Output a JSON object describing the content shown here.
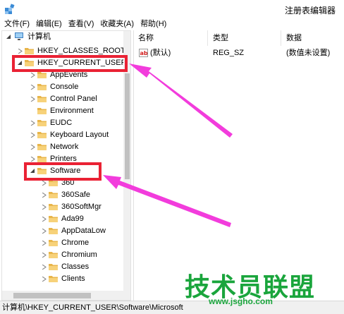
{
  "window": {
    "title": "注册表编辑器",
    "icon": "registry-editor-icon"
  },
  "menu": [
    "文件(F)",
    "编辑(E)",
    "查看(V)",
    "收藏夹(A)",
    "帮助(H)"
  ],
  "tree": {
    "root_label": "计算机",
    "items": [
      {
        "label": "HKEY_CLASSES_ROOT"
      },
      {
        "label": "HKEY_CURRENT_USER",
        "expanded": true
      },
      {
        "label": "AppEvents"
      },
      {
        "label": "Console"
      },
      {
        "label": "Control Panel"
      },
      {
        "label": "Environment"
      },
      {
        "label": "EUDC"
      },
      {
        "label": "Keyboard Layout"
      },
      {
        "label": "Network"
      },
      {
        "label": "Printers"
      },
      {
        "label": "Software",
        "expanded": true
      },
      {
        "label": "360"
      },
      {
        "label": "360Safe"
      },
      {
        "label": "360SoftMgr"
      },
      {
        "label": "Ada99"
      },
      {
        "label": "AppDataLow"
      },
      {
        "label": "Chrome"
      },
      {
        "label": "Chromium"
      },
      {
        "label": "Classes"
      },
      {
        "label": "Clients"
      }
    ]
  },
  "list": {
    "columns": [
      "名称",
      "类型",
      "数据"
    ],
    "rows": [
      {
        "name": "(默认)",
        "type": "REG_SZ",
        "data": "(数值未设置)",
        "icon": "string-value-icon"
      }
    ]
  },
  "status_path": "计算机\\HKEY_CURRENT_USER\\Software\\Microsoft",
  "watermark": {
    "main": "技术员联盟",
    "url": "www.jsgho.com"
  },
  "colors": {
    "highlight": "#ea2234",
    "arrow": "#f23cdc",
    "watermark": "#1aa53c",
    "folder": "#e8b54a"
  }
}
